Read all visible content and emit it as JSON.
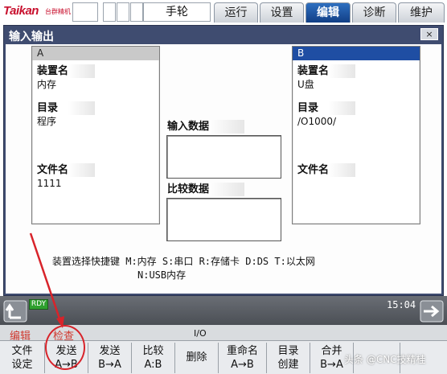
{
  "brand": {
    "logo": "Taikan",
    "logo_sub": "台群精机"
  },
  "mode": "手轮",
  "tabs": [
    {
      "label": "运行",
      "active": false
    },
    {
      "label": "设置",
      "active": false
    },
    {
      "label": "编辑",
      "active": true
    },
    {
      "label": "诊断",
      "active": false
    },
    {
      "label": "维护",
      "active": false
    }
  ],
  "window": {
    "title": "输入输出",
    "close": "×"
  },
  "panel_a": {
    "header": "A",
    "device_label": "装置名",
    "device_value": "内存",
    "dir_label": "目录",
    "dir_value": "程序",
    "file_label": "文件名",
    "file_value": "1111"
  },
  "panel_b": {
    "header": "B",
    "device_label": "装置名",
    "device_value": "U盘",
    "dir_label": "目录",
    "dir_value": "/O1000/",
    "file_label": "文件名",
    "file_value": ""
  },
  "middle": {
    "input_label": "输入数据",
    "input_value": "",
    "compare_label": "比较数据",
    "compare_value": ""
  },
  "hint": {
    "line1": "装置选择快捷键 M:内存 S:串口 R:存储卡 D:DS T:以太网",
    "line2": "N:USB内存"
  },
  "status": {
    "rdy": "RDY",
    "time": "15:04"
  },
  "context": {
    "left": "编辑",
    "right": "检查",
    "io": "I/O"
  },
  "softkeys": [
    {
      "l1": "文件",
      "l2": "设定"
    },
    {
      "l1": "发送",
      "l2": "A→B"
    },
    {
      "l1": "发送",
      "l2": "B→A"
    },
    {
      "l1": "比较",
      "l2": "A:B"
    },
    {
      "l1": "删除",
      "l2": ""
    },
    {
      "l1": "重命名",
      "l2": "A→B"
    },
    {
      "l1": "目录",
      "l2": "创建"
    },
    {
      "l1": "合并",
      "l2": "B→A"
    }
  ],
  "watermark": "头条 @CNC技精桂",
  "colors": {
    "accent": "#1f4ea3",
    "tab_active": "#2e6fc0",
    "rdy": "#2fa02f",
    "annotation": "#d8232a"
  }
}
